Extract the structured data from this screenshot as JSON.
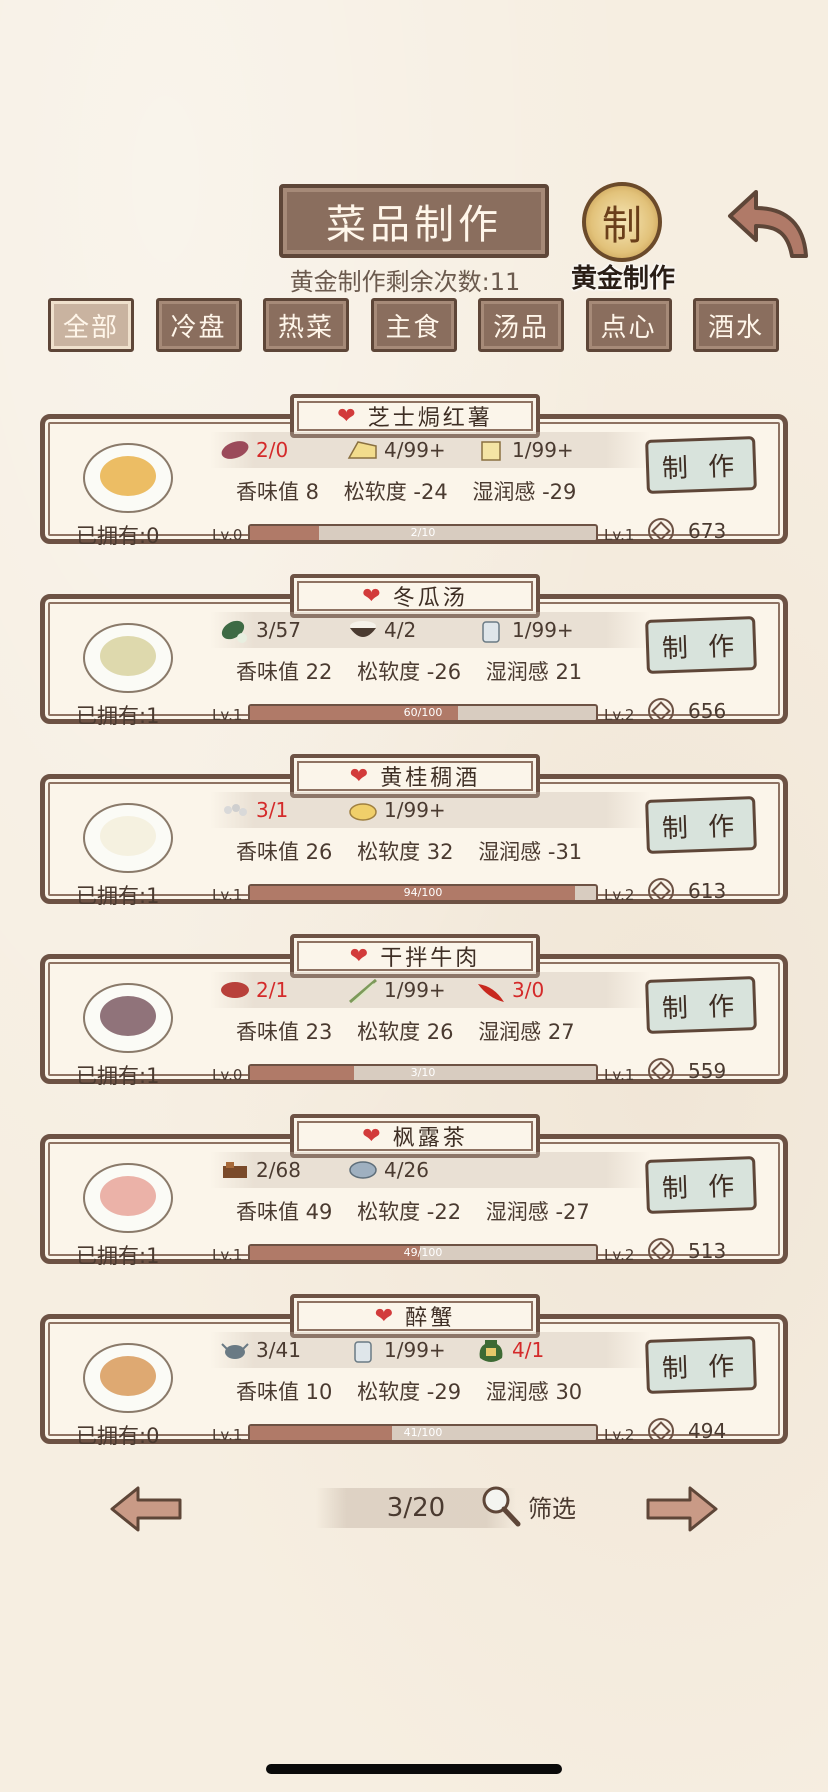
{
  "header": {
    "title": "菜品制作",
    "gold_count_text": "黄金制作剩余次数:11",
    "gold_seal_char": "制",
    "gold_label": "黄金制作"
  },
  "tabs": [
    "全部",
    "冷盘",
    "热菜",
    "主食",
    "汤品",
    "点心",
    "酒水"
  ],
  "active_tab": 0,
  "recipes": [
    {
      "name": "芝士焗红薯",
      "ingredients": [
        {
          "icon": "sweet-potato-icon",
          "count": "2/0",
          "short": true
        },
        {
          "icon": "cheese-icon",
          "count": "4/99+",
          "short": false
        },
        {
          "icon": "butter-icon",
          "count": "1/99+",
          "short": false
        }
      ],
      "stats": {
        "aroma": "香味值 8",
        "softness": "松软度 -24",
        "moisture": "湿润感 -29"
      },
      "owned": "已拥有:0",
      "lv_cur": "Lv.0",
      "lv_next": "Lv.1",
      "progress_text": "2/10",
      "progress": 0.2,
      "make_label": "制 作",
      "cost": "673",
      "dish_color": "#e9b14a",
      "dish_icon": "baked-sweet-potato-icon"
    },
    {
      "name": "冬瓜汤",
      "ingredients": [
        {
          "icon": "winter-melon-icon",
          "count": "3/57",
          "short": false
        },
        {
          "icon": "rice-bowl-icon",
          "count": "4/2",
          "short": false
        },
        {
          "icon": "water-can-icon",
          "count": "1/99+",
          "short": false
        }
      ],
      "stats": {
        "aroma": "香味值 22",
        "softness": "松软度 -26",
        "moisture": "湿润感 21"
      },
      "owned": "已拥有:1",
      "lv_cur": "Lv.1",
      "lv_next": "Lv.2",
      "progress_text": "60/100",
      "progress": 0.6,
      "make_label": "制 作",
      "cost": "656",
      "dish_color": "#d8d2a0",
      "dish_icon": "winter-melon-soup-icon"
    },
    {
      "name": "黄桂稠酒",
      "ingredients": [
        {
          "icon": "osmanthus-icon",
          "count": "3/1",
          "short": true
        },
        {
          "icon": "millet-icon",
          "count": "1/99+",
          "short": false
        }
      ],
      "stats": {
        "aroma": "香味值 26",
        "softness": "松软度 32",
        "moisture": "湿润感 -31"
      },
      "owned": "已拥有:1",
      "lv_cur": "Lv.1",
      "lv_next": "Lv.2",
      "progress_text": "94/100",
      "progress": 0.94,
      "make_label": "制 作",
      "cost": "613",
      "dish_color": "#f3efdc",
      "dish_icon": "rice-wine-icon"
    },
    {
      "name": "干拌牛肉",
      "ingredients": [
        {
          "icon": "beef-icon",
          "count": "2/1",
          "short": true
        },
        {
          "icon": "scallion-icon",
          "count": "1/99+",
          "short": false
        },
        {
          "icon": "chili-icon",
          "count": "3/0",
          "short": true
        }
      ],
      "stats": {
        "aroma": "香味值 23",
        "softness": "松软度 26",
        "moisture": "湿润感 27"
      },
      "owned": "已拥有:1",
      "lv_cur": "Lv.0",
      "lv_next": "Lv.1",
      "progress_text": "3/10",
      "progress": 0.3,
      "make_label": "制 作",
      "cost": "559",
      "dish_color": "#7c5a64",
      "dish_icon": "beef-plate-icon"
    },
    {
      "name": "枫露茶",
      "ingredients": [
        {
          "icon": "tea-leaf-icon",
          "count": "2/68",
          "short": false
        },
        {
          "icon": "water-bowl-icon",
          "count": "4/26",
          "short": false
        }
      ],
      "stats": {
        "aroma": "香味值 49",
        "softness": "松软度 -22",
        "moisture": "湿润感 -27"
      },
      "owned": "已拥有:1",
      "lv_cur": "Lv.1",
      "lv_next": "Lv.2",
      "progress_text": "49/100",
      "progress": 0.49,
      "make_label": "制 作",
      "cost": "513",
      "dish_color": "#e8a49a",
      "dish_icon": "maple-tea-icon"
    },
    {
      "name": "醉蟹",
      "ingredients": [
        {
          "icon": "crab-icon",
          "count": "3/41",
          "short": false
        },
        {
          "icon": "water-can-icon",
          "count": "1/99+",
          "short": false
        },
        {
          "icon": "wine-jar-icon",
          "count": "4/1",
          "short": true
        }
      ],
      "stats": {
        "aroma": "香味值 10",
        "softness": "松软度 -29",
        "moisture": "湿润感 30"
      },
      "owned": "已拥有:0",
      "lv_cur": "Lv.1",
      "lv_next": "Lv.2",
      "progress_text": "41/100",
      "progress": 0.41,
      "make_label": "制 作",
      "cost": "494",
      "dish_color": "#d89a5a",
      "dish_icon": "drunken-crab-icon"
    }
  ],
  "pager": {
    "page": "3/20",
    "filter_label": "筛选"
  },
  "colors": {
    "accent_red": "#d42a2a",
    "frame_brown": "#6d5244",
    "tab_brown": "#8a6e5e",
    "button_mint": "#d8e3dc"
  }
}
